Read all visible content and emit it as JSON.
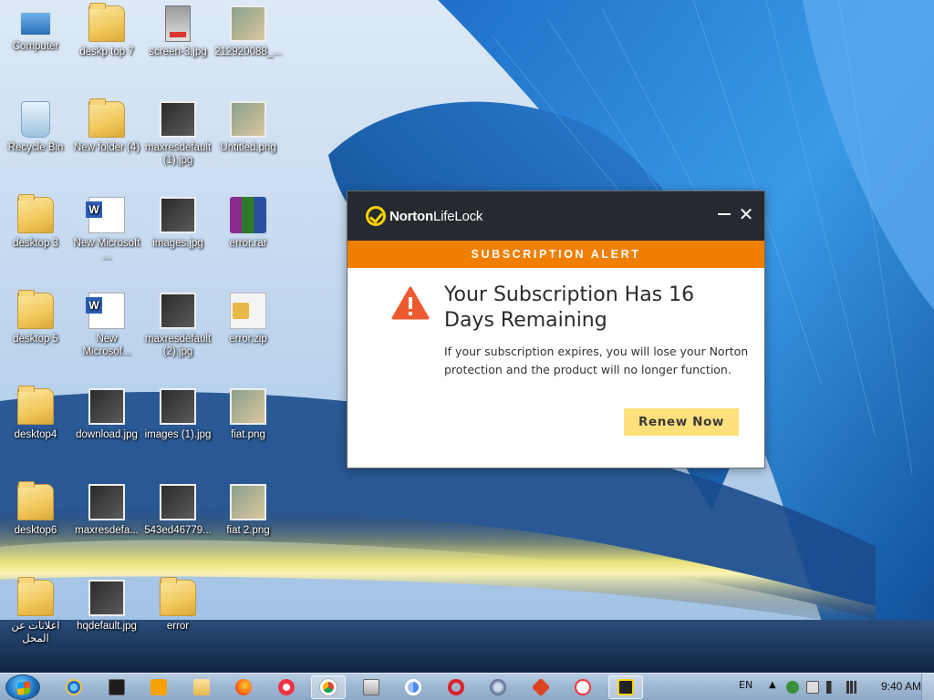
{
  "desktop": {
    "icons": [
      {
        "label": "Computer",
        "type": "computer"
      },
      {
        "label": "deskp top 7",
        "type": "folder"
      },
      {
        "label": "screen-3.jpg",
        "type": "screen"
      },
      {
        "label": "212920088_...",
        "type": "photo-light"
      },
      {
        "label": "Recycle Bin",
        "type": "bin"
      },
      {
        "label": "New folder (4)",
        "type": "folder"
      },
      {
        "label": "maxresdefault (1).jpg",
        "type": "photo"
      },
      {
        "label": "Untitled.png",
        "type": "photo-light"
      },
      {
        "label": "desktop 3",
        "type": "folder"
      },
      {
        "label": "New Microsoft ...",
        "type": "word"
      },
      {
        "label": "images.jpg",
        "type": "photo"
      },
      {
        "label": "error.rar",
        "type": "rar"
      },
      {
        "label": "desktop 5",
        "type": "folder"
      },
      {
        "label": "New Microsof...",
        "type": "word"
      },
      {
        "label": "maxresdefault (2).jpg",
        "type": "photo"
      },
      {
        "label": "error.zip",
        "type": "zip"
      },
      {
        "label": "desktop4",
        "type": "folder"
      },
      {
        "label": "download.jpg",
        "type": "photo"
      },
      {
        "label": "images (1).jpg",
        "type": "photo"
      },
      {
        "label": "fiat.png",
        "type": "photo-light"
      },
      {
        "label": "desktop6",
        "type": "folder"
      },
      {
        "label": "maxresdefa...",
        "type": "photo"
      },
      {
        "label": "543ed46779...",
        "type": "photo"
      },
      {
        "label": "fiat 2.png",
        "type": "photo-light"
      },
      {
        "label": "اعلانات عن المحل",
        "type": "folder"
      },
      {
        "label": "hqdefault.jpg",
        "type": "photo"
      },
      {
        "label": "error",
        "type": "folder"
      }
    ]
  },
  "dialog": {
    "brand_bold": "Norton",
    "brand_light": "LifeLock",
    "minimize_icon": "minimize-icon",
    "close_glyph": "✕",
    "band_text": "SUBSCRIPTION ALERT",
    "headline": "Your Subscription Has 16 Days Remaining",
    "message": "If your subscription expires, you will lose your Norton protection and the product will no longer function.",
    "renew_label": "Renew Now",
    "colors": {
      "titlebar": "#242a2f",
      "band": "#f07f00",
      "warning": "#ee5a2f",
      "button": "#ffe07a",
      "brand_accent": "#ffd200"
    }
  },
  "taskbar": {
    "apps": [
      {
        "name": "internet-explorer",
        "glyph": "g-ie"
      },
      {
        "name": "terminal",
        "glyph": "g-term"
      },
      {
        "name": "media-player",
        "glyph": "g-media"
      },
      {
        "name": "file-explorer",
        "glyph": "g-explorer"
      },
      {
        "name": "firefox",
        "glyph": "g-firefox"
      },
      {
        "name": "opera-gx",
        "glyph": "g-opera-alt"
      },
      {
        "name": "chrome",
        "glyph": "g-chrome",
        "active": true
      },
      {
        "name": "calculator",
        "glyph": "g-calc"
      },
      {
        "name": "chromium",
        "glyph": "g-chromium"
      },
      {
        "name": "opera",
        "glyph": "g-opera"
      },
      {
        "name": "browser-globe",
        "glyph": "g-globe"
      },
      {
        "name": "heart-app",
        "glyph": "g-heart"
      },
      {
        "name": "yandex",
        "glyph": "g-yandex"
      },
      {
        "name": "norton",
        "glyph": "g-norton",
        "active": true
      }
    ],
    "language": "EN",
    "tray_chevron": "▲",
    "clock": "9:40 AM"
  }
}
